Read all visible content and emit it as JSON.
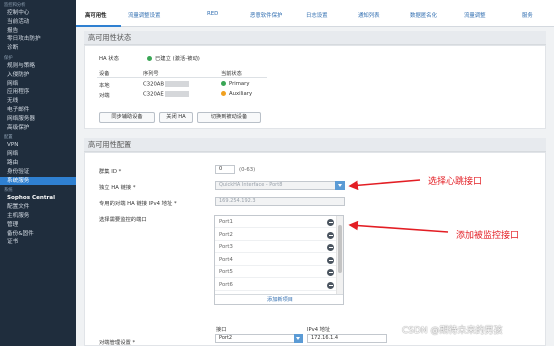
{
  "sidebar": {
    "items": [
      {
        "kind": "sec",
        "label": "监控和分析"
      },
      {
        "kind": "item",
        "label": "控制中心"
      },
      {
        "kind": "item",
        "label": "当前活动"
      },
      {
        "kind": "item",
        "label": "报告"
      },
      {
        "kind": "item",
        "label": "零日攻击防护"
      },
      {
        "kind": "item",
        "label": "诊断"
      },
      {
        "kind": "sec",
        "label": "保护"
      },
      {
        "kind": "item",
        "label": "规则与策略"
      },
      {
        "kind": "item",
        "label": "入侵防护"
      },
      {
        "kind": "item",
        "label": "网络"
      },
      {
        "kind": "item",
        "label": "应用程序"
      },
      {
        "kind": "item",
        "label": "无线"
      },
      {
        "kind": "item",
        "label": "电子邮件"
      },
      {
        "kind": "item",
        "label": "网络服务器"
      },
      {
        "kind": "item",
        "label": "高级保护"
      },
      {
        "kind": "sec",
        "label": "配置"
      },
      {
        "kind": "item",
        "label": "VPN"
      },
      {
        "kind": "item",
        "label": "网络"
      },
      {
        "kind": "item",
        "label": "路由"
      },
      {
        "kind": "item",
        "label": "身份验证"
      },
      {
        "kind": "item",
        "label": "系统服务",
        "active": true
      },
      {
        "kind": "sec",
        "label": "系统"
      },
      {
        "kind": "item",
        "label": "Sophos Central",
        "bold": true
      },
      {
        "kind": "item",
        "label": "配置文件"
      },
      {
        "kind": "item",
        "label": "主机服务"
      },
      {
        "kind": "item",
        "label": "管理"
      },
      {
        "kind": "item",
        "label": "备份&固件"
      },
      {
        "kind": "item",
        "label": "证书"
      }
    ]
  },
  "tabs": [
    "高可用性",
    "流量调整设置",
    "RED",
    "恶意软件保护",
    "日志设置",
    "通知列表",
    "数据匿名化",
    "流量调整",
    "服务"
  ],
  "ha_status": {
    "title": "高可用性状态",
    "ha_status_label": "HA 状态",
    "ha_status_value": "已建立 (激活-被动)",
    "colors": {
      "green": "#3aa655",
      "orange": "#f0a020"
    },
    "headers": [
      "设备",
      "序列号",
      "当前状态"
    ],
    "rows": [
      {
        "device": "本地",
        "serial": "C320AB",
        "state": "Primary"
      },
      {
        "device": "对端",
        "serial": "C320AE",
        "state": "Auxiliary"
      }
    ],
    "buttons": [
      "同步辅助设备",
      "关闭 HA",
      "切换到被动设备"
    ]
  },
  "ha_config": {
    "title": "高可用性配置",
    "cluster_id_label": "群集 ID *",
    "cluster_id_value": "0",
    "cluster_id_range": "(0-63)",
    "link_label": "独立 HA 链接 *",
    "link_value": "QuickHA Interface - Port8",
    "peer_ip_label": "专用的对端 HA 链接 IPv4 地址 *",
    "peer_ip_value": "169.254.192.3",
    "monitor_label": "选择需要监控的端口",
    "ports": [
      "Port1",
      "Port2",
      "Port3",
      "Port4",
      "Port5",
      "Port6",
      "Port7"
    ],
    "add_new": "添加新项目",
    "peer_mgmt_label": "对端管理设置 *",
    "col_interface": "接口",
    "col_ipv4": "IPv4 地址",
    "peer_interface": "Port2",
    "peer_ipv4": "172.16.1.4"
  },
  "annotations": {
    "heartbeat": "选择心跳接口",
    "monitor": "添加被监控接口",
    "color": "#e31e24"
  },
  "watermark": "CSDN @期待未来的男孩"
}
